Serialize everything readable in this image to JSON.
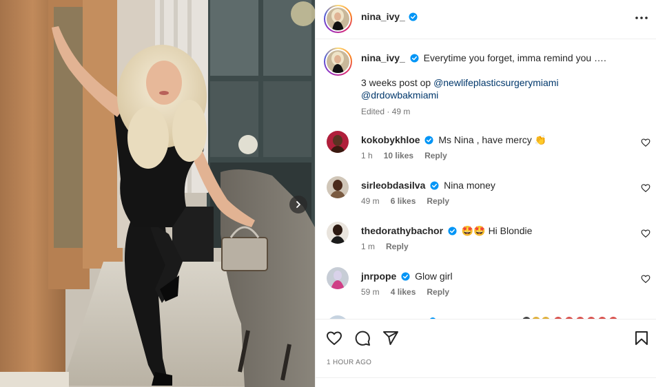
{
  "post": {
    "username": "nina_ivy_",
    "caption_text": "Everytime you forget, imma remind you ….",
    "caption_line2_prefix": "3 weeks post op",
    "mention_1": "@newlifeplasticsurgerymiami",
    "mention_2": "@drdowbakmiami",
    "edited_meta": "Edited · 49 m",
    "timestamp": "1 HOUR AGO"
  },
  "comments": [
    {
      "user": "kokobykhloe",
      "verified": true,
      "text": "Ms Nina , have mercy",
      "emoji": "👏",
      "time": "1 h",
      "likes": "10 likes",
      "reply": "Reply"
    },
    {
      "user": "sirleobdasilva",
      "verified": true,
      "text": "Nina money",
      "emoji": "",
      "time": "49 m",
      "likes": "6 likes",
      "reply": "Reply"
    },
    {
      "user": "thedorathybachor",
      "verified": true,
      "text": "Hi Blondie",
      "emoji": "🤩🤩",
      "time": "1 m",
      "likes": "",
      "reply": "Reply"
    },
    {
      "user": "jnrpope",
      "verified": true,
      "text": "Glow girl",
      "emoji": "",
      "time": "59 m",
      "likes": "4 likes",
      "reply": "Reply"
    }
  ],
  "icons": {
    "verified": "verified-badge-icon",
    "more": "more-options-icon",
    "like": "heart-icon",
    "comment": "comment-icon",
    "share": "share-icon",
    "save": "bookmark-icon",
    "next": "chevron-right-icon"
  },
  "colors": {
    "verified": "#0095f6",
    "link": "#00376b",
    "meta": "#737373"
  }
}
